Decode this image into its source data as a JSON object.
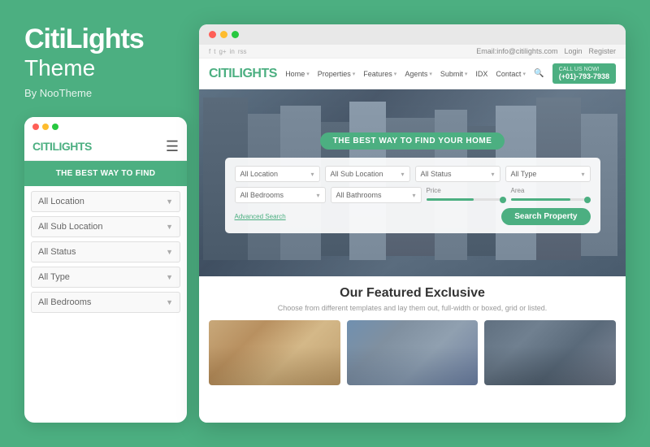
{
  "brand": {
    "name": "CitiLights",
    "subtitle": "Theme",
    "by": "By NooTheme"
  },
  "mobile": {
    "logo": "CITI",
    "logo_accent": "LIGHTS",
    "hero_text": "THE BEST WAY TO FIND",
    "filters": [
      {
        "label": "All Location"
      },
      {
        "label": "All Sub Location"
      },
      {
        "label": "All Status"
      },
      {
        "label": "All Type"
      },
      {
        "label": "All Bedrooms"
      }
    ]
  },
  "desktop": {
    "utility": {
      "social": [
        "f",
        "t",
        "g+",
        "in",
        "rss"
      ],
      "email": "Email:info@citilights.com",
      "login": "Login",
      "register": "Register"
    },
    "nav": {
      "logo": "CITI",
      "logo_accent": "LIGHTS",
      "links": [
        "Home",
        "Properties",
        "Features",
        "Agents",
        "Submit",
        "IDX",
        "Contact"
      ],
      "phone_label": "CALL US NOW!",
      "phone": "(+01)-793-7938"
    },
    "hero": {
      "badge": "THE BEST WAY TO FIND YOUR HOME",
      "filters_row1": [
        "All Location",
        "All Sub Location",
        "All Status",
        "All Type"
      ],
      "filters_row2": [
        "All Bedrooms",
        "All Bathrooms"
      ],
      "price_label": "Price",
      "area_label": "Area",
      "advanced_search": "Advanced Search",
      "search_button": "Search Property"
    },
    "featured": {
      "title": "Our Featured Exclusive",
      "subtitle": "Choose from different templates and lay them out, full-width or boxed, grid or listed."
    }
  }
}
